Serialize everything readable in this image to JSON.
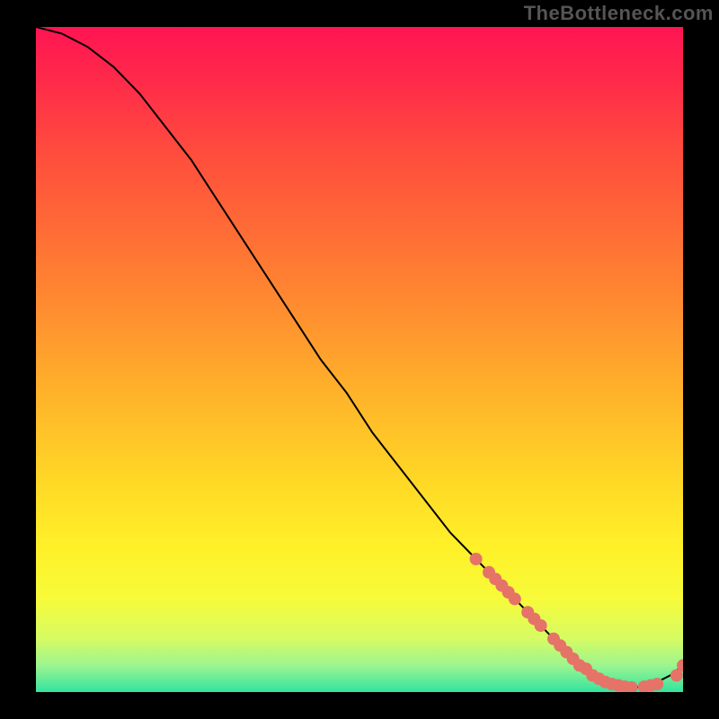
{
  "watermark": "TheBottleneck.com",
  "colors": {
    "page_bg": "#000000",
    "curve_stroke": "#000000",
    "point_fill": "#e57368",
    "gradient_stops": [
      {
        "offset": 0.0,
        "color": "#ff1452"
      },
      {
        "offset": 0.08,
        "color": "#ff2a4a"
      },
      {
        "offset": 0.18,
        "color": "#ff4a3e"
      },
      {
        "offset": 0.3,
        "color": "#ff6a36"
      },
      {
        "offset": 0.42,
        "color": "#ff8c30"
      },
      {
        "offset": 0.55,
        "color": "#ffb22a"
      },
      {
        "offset": 0.68,
        "color": "#ffd726"
      },
      {
        "offset": 0.78,
        "color": "#fff028"
      },
      {
        "offset": 0.86,
        "color": "#f7fb3a"
      },
      {
        "offset": 0.92,
        "color": "#d6fb63"
      },
      {
        "offset": 0.96,
        "color": "#9cf58f"
      },
      {
        "offset": 1.0,
        "color": "#34e3a0"
      }
    ]
  },
  "chart_data": {
    "type": "line",
    "title": "",
    "xlabel": "",
    "ylabel": "",
    "xlim": [
      0,
      100
    ],
    "ylim": [
      0,
      100
    ],
    "series": [
      {
        "name": "bottleneck-curve",
        "x": [
          0,
          4,
          8,
          12,
          16,
          20,
          24,
          28,
          32,
          36,
          40,
          44,
          48,
          52,
          56,
          60,
          64,
          68,
          72,
          76,
          80,
          82,
          84,
          86,
          88,
          90,
          92,
          94,
          96,
          98,
          100
        ],
        "y": [
          100,
          99,
          97,
          94,
          90,
          85,
          80,
          74,
          68,
          62,
          56,
          50,
          45,
          39,
          34,
          29,
          24,
          20,
          16,
          12,
          8,
          6,
          4,
          2,
          1,
          0.5,
          0.5,
          1,
          1.5,
          2.5,
          4
        ]
      }
    ],
    "highlight_points": {
      "name": "marker-cluster",
      "x": [
        68,
        70,
        71,
        72,
        73,
        74,
        76,
        77,
        78,
        80,
        81,
        82,
        83,
        84,
        85,
        86,
        87,
        88,
        89,
        90,
        91,
        92,
        94,
        95,
        96,
        99,
        100
      ],
      "y": [
        20,
        18,
        17,
        16,
        15,
        14,
        12,
        11,
        10,
        8,
        7,
        6,
        5,
        4,
        3.5,
        2.5,
        2,
        1.5,
        1.2,
        1,
        0.8,
        0.7,
        0.8,
        1,
        1.2,
        2.5,
        4
      ]
    }
  }
}
